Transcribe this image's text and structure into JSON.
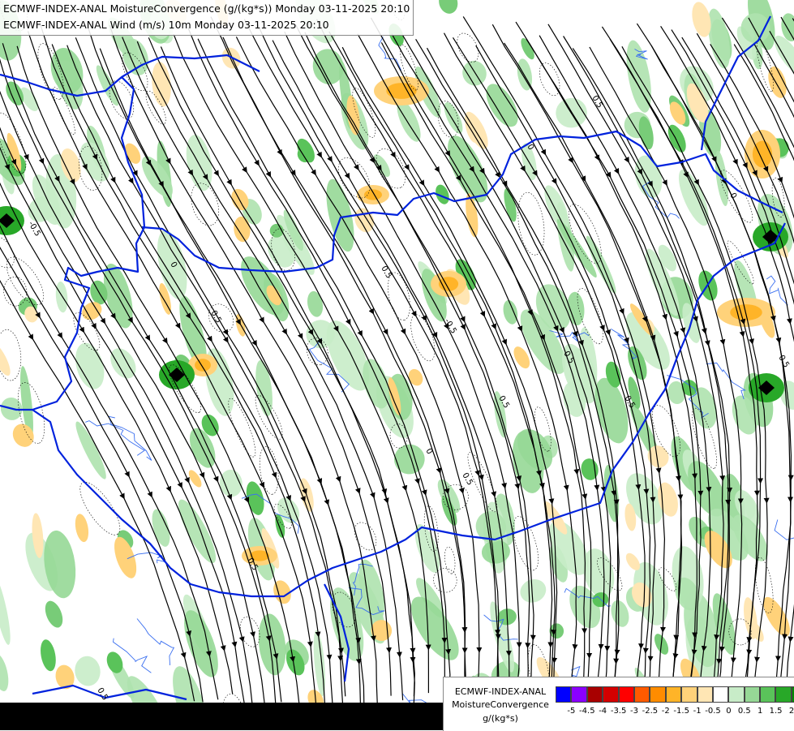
{
  "titles": {
    "line1": "ECMWF-INDEX-ANAL MoistureConvergence (g/(kg*s)) Monday 03-11-2025 20:10",
    "line2": "ECMWF-INDEX-ANAL Wind (m/s) 10m Monday 03-11-2025 20:10"
  },
  "legend": {
    "label_line1": "ECMWF-INDEX-ANAL",
    "label_line2": "MoistureConvergence",
    "label_line3": "g/(kg*s)",
    "colors": [
      "#0000ff",
      "#8a00ff",
      "#a80000",
      "#d40000",
      "#ff0000",
      "#ff5a00",
      "#ff8c00",
      "#ffb428",
      "#ffd27a",
      "#ffe6b4",
      "#ffffff",
      "#c8ecc8",
      "#96d896",
      "#5ac35a",
      "#28a828",
      "#008c00"
    ],
    "ticks": [
      "-5",
      "-4.5",
      "-4",
      "-3.5",
      "-3",
      "-2.5",
      "-2",
      "-1.5",
      "-1",
      "-0.5",
      "0",
      "0.5",
      "1",
      "1.5",
      "2"
    ]
  },
  "contour_labels": [
    "0",
    "0.5",
    "-0.5"
  ],
  "colors": {
    "border": "#0022dd",
    "river": "#3a6ff0",
    "streamline": "#000000",
    "convergence": "#96d896",
    "divergence": "#ffcf80"
  }
}
